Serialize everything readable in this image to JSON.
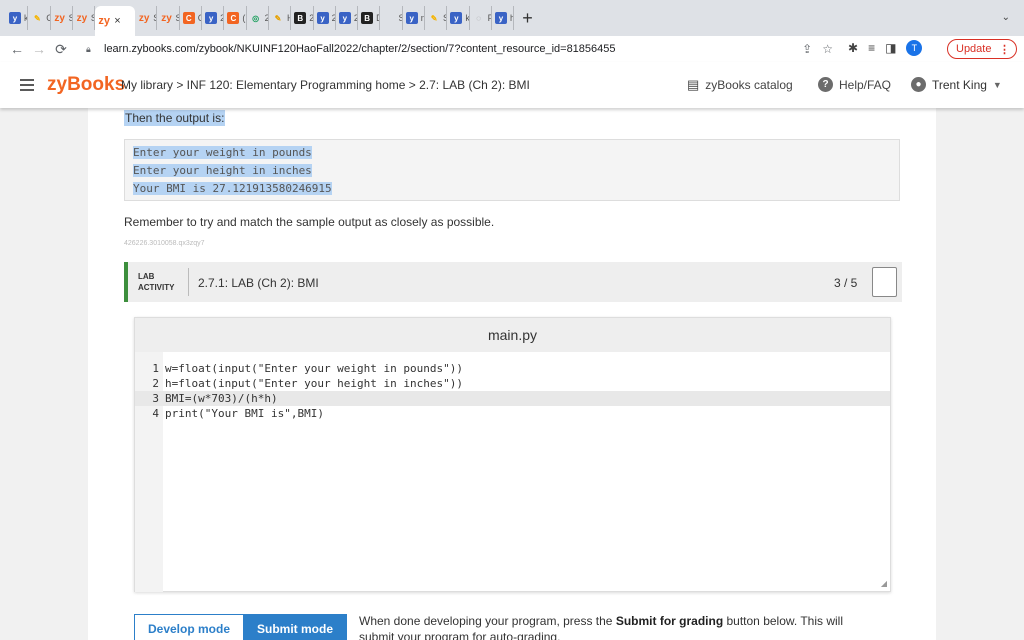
{
  "browser": {
    "tabs": [
      {
        "icon": "zybooks-y-icon",
        "label": "ke",
        "color": "#3a63c5"
      },
      {
        "icon": "pencil-icon",
        "label": "Gr",
        "color": "#f5b400"
      },
      {
        "icon": "zy-icon",
        "label": "Se",
        "color": "#f26522"
      },
      {
        "icon": "zy-icon",
        "label": "Se",
        "color": "#f26522"
      },
      {
        "icon": "zy-icon",
        "label": "Se",
        "color": "#f26522"
      },
      {
        "icon": "zy-icon",
        "label": "Se",
        "color": "#f26522"
      },
      {
        "icon": "c-icon",
        "label": "Cl",
        "color": "#f26522"
      },
      {
        "icon": "zybooks-y-icon",
        "label": "2.",
        "color": "#3a63c5"
      },
      {
        "icon": "c-icon",
        "label": "(",
        "color": "#f26522"
      },
      {
        "icon": "globe-icon",
        "label": "2.",
        "color": "#1a9e5c"
      },
      {
        "icon": "pencil-icon",
        "label": "Ho",
        "color": "#e6a100"
      },
      {
        "icon": "b-icon",
        "label": "2.",
        "color": "#222"
      },
      {
        "icon": "zybooks-y-icon",
        "label": "2.",
        "color": "#3a63c5"
      },
      {
        "icon": "zybooks-y-icon",
        "label": "2.",
        "color": "#3a63c5"
      },
      {
        "icon": "b-icon",
        "label": "Dr",
        "color": "#222"
      },
      {
        "icon": "apple-icon",
        "label": "Si",
        "color": "#888"
      },
      {
        "icon": "zybooks-y-icon",
        "label": "nk",
        "color": "#3a63c5"
      },
      {
        "icon": "pencil-icon",
        "label": "Si",
        "color": "#f5b400"
      },
      {
        "icon": "zybooks-y-icon",
        "label": "ke",
        "color": "#3a63c5"
      },
      {
        "icon": "spinner-icon",
        "label": "Fu",
        "color": "#888"
      },
      {
        "icon": "zybooks-y-icon",
        "label": "ho",
        "color": "#3a63c5"
      }
    ],
    "active_tab": {
      "icon": "zy-icon",
      "label": "zy",
      "close": "×"
    },
    "new_tab": "+",
    "url": "learn.zybooks.com/zybook/NKUINF120HaoFall2022/chapter/2/section/7?content_resource_id=81856455",
    "update_label": "Update",
    "profile_initial": "T"
  },
  "header": {
    "brand": "zyBooks",
    "breadcrumb": "My library > INF 120: Elementary Programming home > 2.7: LAB (Ch 2): BMI",
    "catalog": "zyBooks catalog",
    "help": "Help/FAQ",
    "user": "Trent King"
  },
  "content": {
    "output_label": "Then the output is:",
    "sample_output": [
      "Enter your weight in pounds",
      "Enter your height in inches",
      "Your BMI is 27.121913580246915"
    ],
    "remember": "Remember to try and match the sample output as closely as possible.",
    "tiny_id": "426226.3010058.qx3zqy7"
  },
  "lab": {
    "tag_line1": "LAB",
    "tag_line2": "ACTIVITY",
    "title": "2.7.1: LAB (Ch 2): BMI",
    "score": "3 / 5",
    "file_name": "main.py"
  },
  "code": {
    "lines": [
      "w=float(input(\"Enter your weight in pounds\"))",
      "h=float(input(\"Enter your height in inches\"))",
      "BMI=(w*703)/(h*h)",
      "print(\"Your BMI is\",BMI)"
    ]
  },
  "footer": {
    "develop_mode": "Develop mode",
    "submit_mode": "Submit mode",
    "note_pre": "When done developing your program, press the ",
    "note_bold": "Submit for grading",
    "note_post": " button below. This will submit your program for auto-grading."
  }
}
